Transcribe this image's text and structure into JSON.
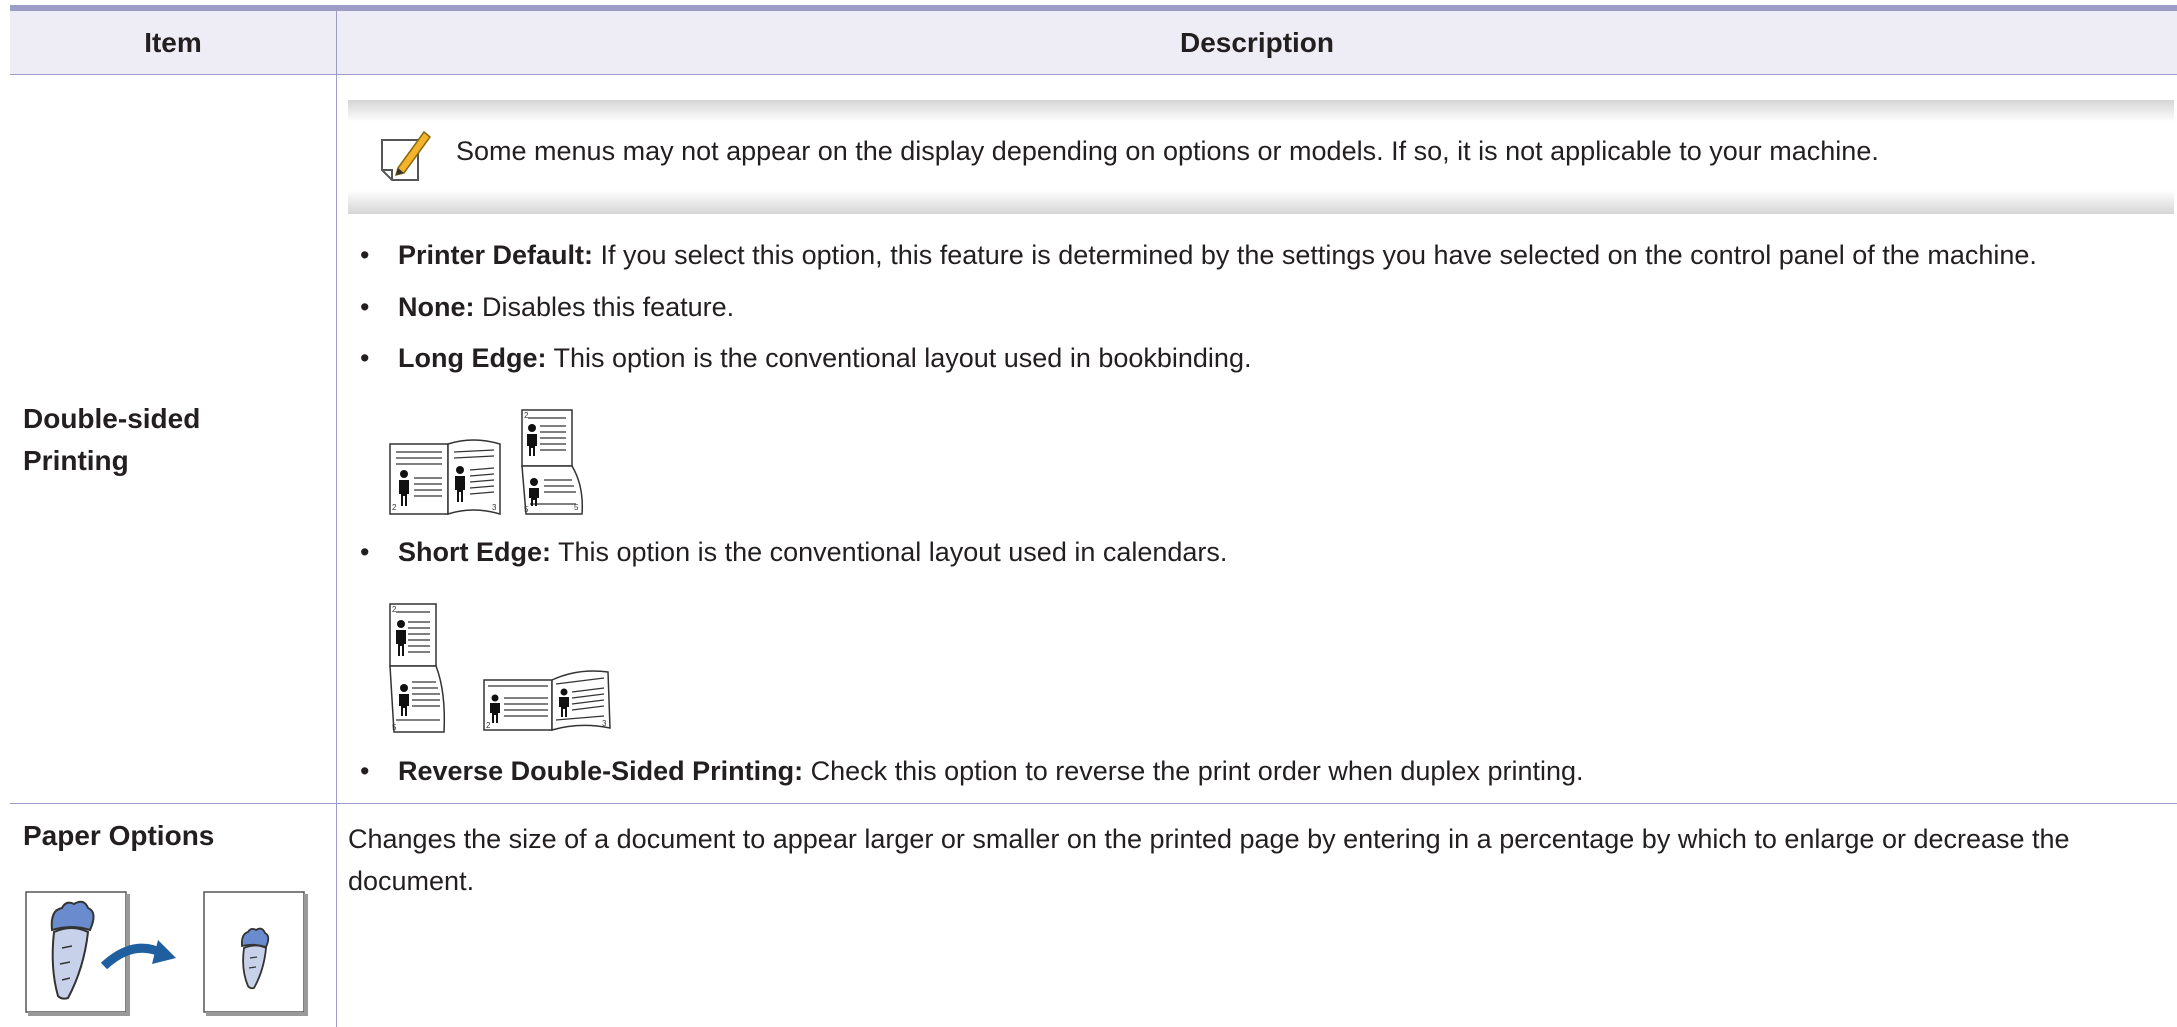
{
  "table": {
    "headers": {
      "item": "Item",
      "description": "Description"
    },
    "rows": [
      {
        "item": "Double-sided Printing",
        "note": {
          "icon": "note-pencil-icon",
          "text": "Some menus may not appear on the display depending on options or models. If so, it is not applicable to your machine."
        },
        "options": [
          {
            "label": "Printer Default:",
            "text": " If you select this option, this feature is determined by the settings you have selected on the control panel of the machine."
          },
          {
            "label": "None:",
            "text": " Disables this feature."
          },
          {
            "label": "Long Edge:",
            "text": " This option is the conventional layout used in bookbinding."
          },
          {
            "label": "Short Edge:",
            "text": " This option is the conventional layout used in calendars."
          },
          {
            "label": "Reverse Double-Sided Printing:",
            "text": " Check this option to reverse the print order when duplex printing."
          }
        ],
        "page_numbers": [
          "2",
          "3",
          "5"
        ]
      },
      {
        "item": "Paper Options",
        "description": "Changes the size of a document to appear larger or smaller on the printed page by entering in a percentage by which to enlarge or decrease the document.",
        "figure_icon": "scale-down-icon"
      }
    ]
  },
  "colors": {
    "rule": "#9d9cc6",
    "header_bg": "#eeedf6",
    "arrow": "#1f5f9f",
    "carrot": "#6a8ccf"
  }
}
